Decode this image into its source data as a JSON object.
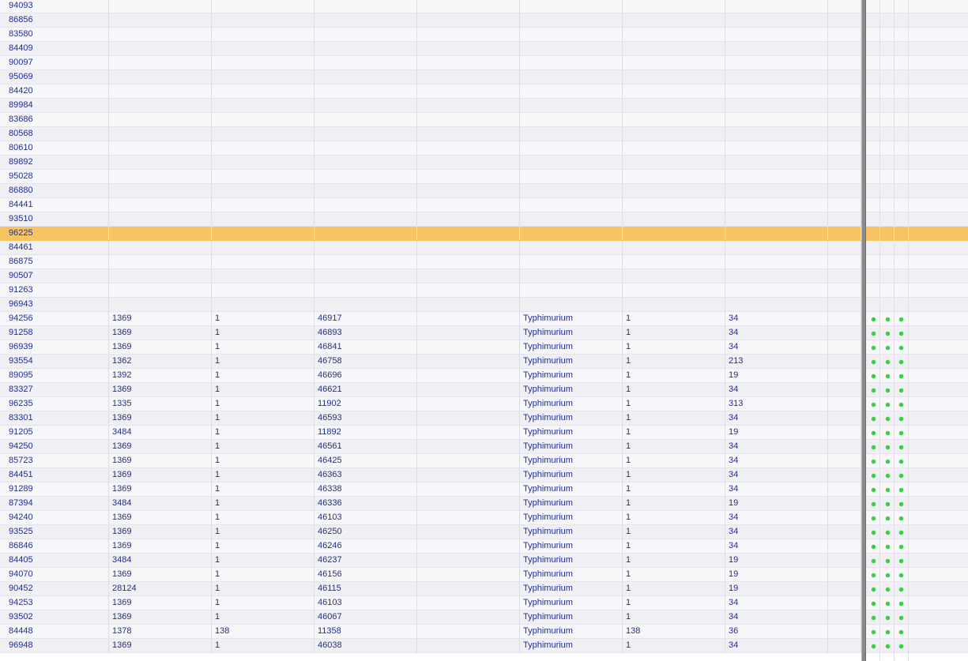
{
  "grid": {
    "rows": [
      {
        "id": "94093"
      },
      {
        "id": "86856"
      },
      {
        "id": "83580"
      },
      {
        "id": "84409"
      },
      {
        "id": "90097"
      },
      {
        "id": "95069"
      },
      {
        "id": "84420"
      },
      {
        "id": "89984"
      },
      {
        "id": "83686"
      },
      {
        "id": "80568"
      },
      {
        "id": "80610"
      },
      {
        "id": "89892"
      },
      {
        "id": "95028"
      },
      {
        "id": "86880"
      },
      {
        "id": "84441"
      },
      {
        "id": "93510"
      },
      {
        "id": "96225",
        "selected": true
      },
      {
        "id": "84461"
      },
      {
        "id": "86875"
      },
      {
        "id": "90507"
      },
      {
        "id": "91263"
      },
      {
        "id": "96943"
      },
      {
        "id": "94256",
        "c1": "1369",
        "c2": "1",
        "c3": "46917",
        "c5": "Typhimurium",
        "c6": "1",
        "c7": "34",
        "status": true
      },
      {
        "id": "91258",
        "c1": "1369",
        "c2": "1",
        "c3": "46893",
        "c5": "Typhimurium",
        "c6": "1",
        "c7": "34",
        "status": true
      },
      {
        "id": "96939",
        "c1": "1369",
        "c2": "1",
        "c3": "46841",
        "c5": "Typhimurium",
        "c6": "1",
        "c7": "34",
        "status": true
      },
      {
        "id": "93554",
        "c1": "1362",
        "c2": "1",
        "c3": "46758",
        "c5": "Typhimurium",
        "c6": "1",
        "c7": "213",
        "status": true
      },
      {
        "id": "89095",
        "c1": "1392",
        "c2": "1",
        "c3": "46696",
        "c5": "Typhimurium",
        "c6": "1",
        "c7": "19",
        "status": true
      },
      {
        "id": "83327",
        "c1": "1369",
        "c2": "1",
        "c3": "46621",
        "c5": "Typhimurium",
        "c6": "1",
        "c7": "34",
        "status": true
      },
      {
        "id": "96235",
        "c1": "1335",
        "c2": "1",
        "c3": "11902",
        "c5": "Typhimurium",
        "c6": "1",
        "c7": "313",
        "status": true
      },
      {
        "id": "83301",
        "c1": "1369",
        "c2": "1",
        "c3": "46593",
        "c5": "Typhimurium",
        "c6": "1",
        "c7": "34",
        "status": true
      },
      {
        "id": "91205",
        "c1": "3484",
        "c2": "1",
        "c3": "11892",
        "c5": "Typhimurium",
        "c6": "1",
        "c7": "19",
        "status": true
      },
      {
        "id": "94250",
        "c1": "1369",
        "c2": "1",
        "c3": "46561",
        "c5": "Typhimurium",
        "c6": "1",
        "c7": "34",
        "status": true
      },
      {
        "id": "85723",
        "c1": "1369",
        "c2": "1",
        "c3": "46425",
        "c5": "Typhimurium",
        "c6": "1",
        "c7": "34",
        "status": true
      },
      {
        "id": "84451",
        "c1": "1369",
        "c2": "1",
        "c3": "46363",
        "c5": "Typhimurium",
        "c6": "1",
        "c7": "34",
        "status": true
      },
      {
        "id": "91289",
        "c1": "1369",
        "c2": "1",
        "c3": "46338",
        "c5": "Typhimurium",
        "c6": "1",
        "c7": "34",
        "status": true
      },
      {
        "id": "87394",
        "c1": "3484",
        "c2": "1",
        "c3": "46336",
        "c5": "Typhimurium",
        "c6": "1",
        "c7": "19",
        "status": true
      },
      {
        "id": "94240",
        "c1": "1369",
        "c2": "1",
        "c3": "46103",
        "c5": "Typhimurium",
        "c6": "1",
        "c7": "34",
        "status": true
      },
      {
        "id": "93525",
        "c1": "1369",
        "c2": "1",
        "c3": "46250",
        "c5": "Typhimurium",
        "c6": "1",
        "c7": "34",
        "status": true
      },
      {
        "id": "86846",
        "c1": "1369",
        "c2": "1",
        "c3": "46246",
        "c5": "Typhimurium",
        "c6": "1",
        "c7": "34",
        "status": true
      },
      {
        "id": "84405",
        "c1": "3484",
        "c2": "1",
        "c3": "46237",
        "c5": "Typhimurium",
        "c6": "1",
        "c7": "19",
        "status": true
      },
      {
        "id": "94070",
        "c1": "1369",
        "c2": "1",
        "c3": "46156",
        "c5": "Typhimurium",
        "c6": "1",
        "c7": "19",
        "status": true
      },
      {
        "id": "90452",
        "c1": "28124",
        "c2": "1",
        "c3": "46115",
        "c5": "Typhimurium",
        "c6": "1",
        "c7": "19",
        "status": true
      },
      {
        "id": "94253",
        "c1": "1369",
        "c2": "1",
        "c3": "46103",
        "c5": "Typhimurium",
        "c6": "1",
        "c7": "34",
        "status": true
      },
      {
        "id": "93502",
        "c1": "1369",
        "c2": "1",
        "c3": "46067",
        "c5": "Typhimurium",
        "c6": "1",
        "c7": "34",
        "status": true
      },
      {
        "id": "84448",
        "c1": "1378",
        "c2": "138",
        "c3": "11358",
        "c5": "Typhimurium",
        "c6": "138",
        "c7": "36",
        "status": true
      },
      {
        "id": "96948",
        "c1": "1369",
        "c2": "1",
        "c3": "46038",
        "c5": "Typhimurium",
        "c6": "1",
        "c7": "34",
        "status": true
      }
    ]
  },
  "colors": {
    "selected_row": "#f8c462",
    "text": "#1f2f96",
    "status_dot": "#36d03e"
  },
  "icons": {
    "status": "status-dot-icon"
  }
}
